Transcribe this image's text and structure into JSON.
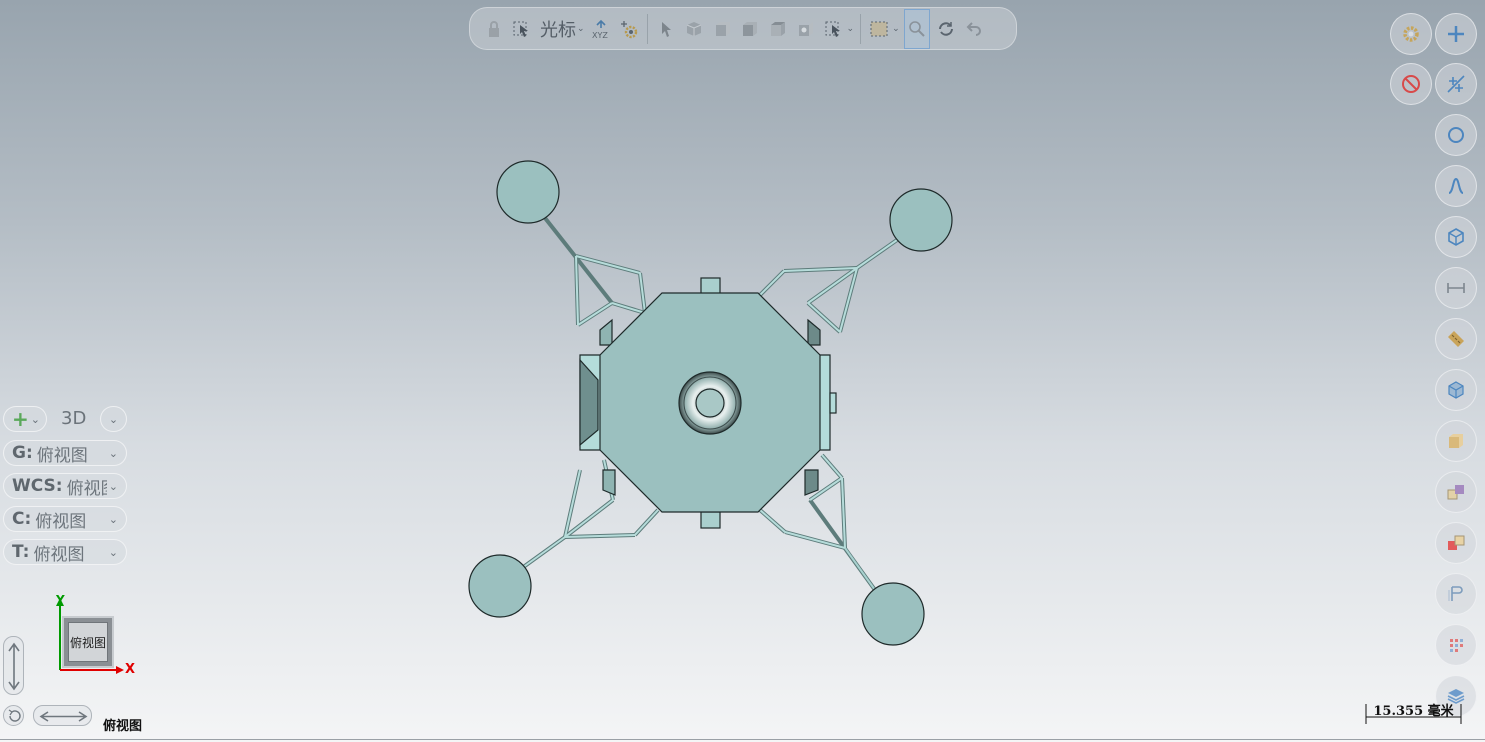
{
  "toolbar": {
    "cursor_label": "光标",
    "icons": [
      "lock-icon",
      "select-icon",
      "xyz-axis-icon",
      "snap-gear-icon",
      "arrow-pointer-icon",
      "cube-icon",
      "view-icon",
      "filter-icon",
      "box-select-icon",
      "pan-icon",
      "rotate-icon",
      "undo-view-icon"
    ]
  },
  "left_panel": {
    "view_mode": "3D",
    "rows": [
      {
        "prefix": "G:",
        "value": "俯视图"
      },
      {
        "prefix": "WCS:",
        "value": "俯视图"
      },
      {
        "prefix": "C:",
        "value": "俯视图"
      },
      {
        "prefix": "T:",
        "value": "俯视图"
      }
    ]
  },
  "triad": {
    "x_label": "X",
    "y_label": "Y",
    "cube_face": "俯视图",
    "x_color": "#e00000",
    "y_color": "#009a00"
  },
  "view_label": "俯视图",
  "scale_bar": {
    "label": "15.355 毫米"
  },
  "right_sidebar": {
    "icons": [
      "settings-gear-icon",
      "add-icon",
      "no-entry-icon",
      "point-icon",
      "circle-icon",
      "curve-icon",
      "solid-icon",
      "measure-icon",
      "ruler-icon",
      "view-cube-icon",
      "material-icon",
      "boolean-icon",
      "subtract-icon",
      "annotation-icon",
      "grid-icon",
      "layers-icon"
    ]
  },
  "model": {
    "body_color": "#9bc0bf",
    "outline_color": "#1e2a2a",
    "strut_color": "#a9d2d0"
  }
}
